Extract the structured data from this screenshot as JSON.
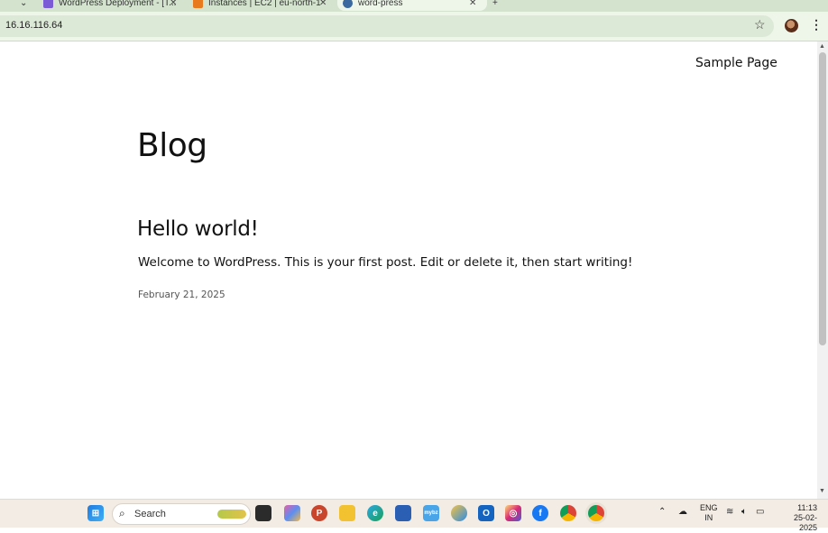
{
  "browser": {
    "tabs": [
      {
        "title": "WordPress Deployment - [T...",
        "active": false,
        "favicon_color": "#7b5cd6"
      },
      {
        "title": "Instances | EC2 | eu-north-1",
        "active": false,
        "favicon_color": "#e8791c"
      },
      {
        "title": "word-press",
        "active": true,
        "favicon_color": "#3b6aa0"
      }
    ],
    "address": "16.16.116.64"
  },
  "site": {
    "nav_link": "Sample Page",
    "blog_title": "Blog",
    "post": {
      "title": "Hello world!",
      "excerpt": "Welcome to WordPress. This is your first post. Edit or delete it, then start writing!",
      "date": "February 21, 2025"
    }
  },
  "taskbar": {
    "search_label": "Search",
    "apps": [
      "windows-start",
      "search",
      "file-explorer-app",
      "copilot",
      "powerpoint",
      "folder",
      "edge",
      "store",
      "mybizz",
      "paint",
      "outlook",
      "instagram",
      "facebook",
      "chrome",
      "chrome-active"
    ],
    "language": {
      "line1": "ENG",
      "line2": "IN"
    },
    "time": "11:13",
    "date": "25-02-2025"
  }
}
